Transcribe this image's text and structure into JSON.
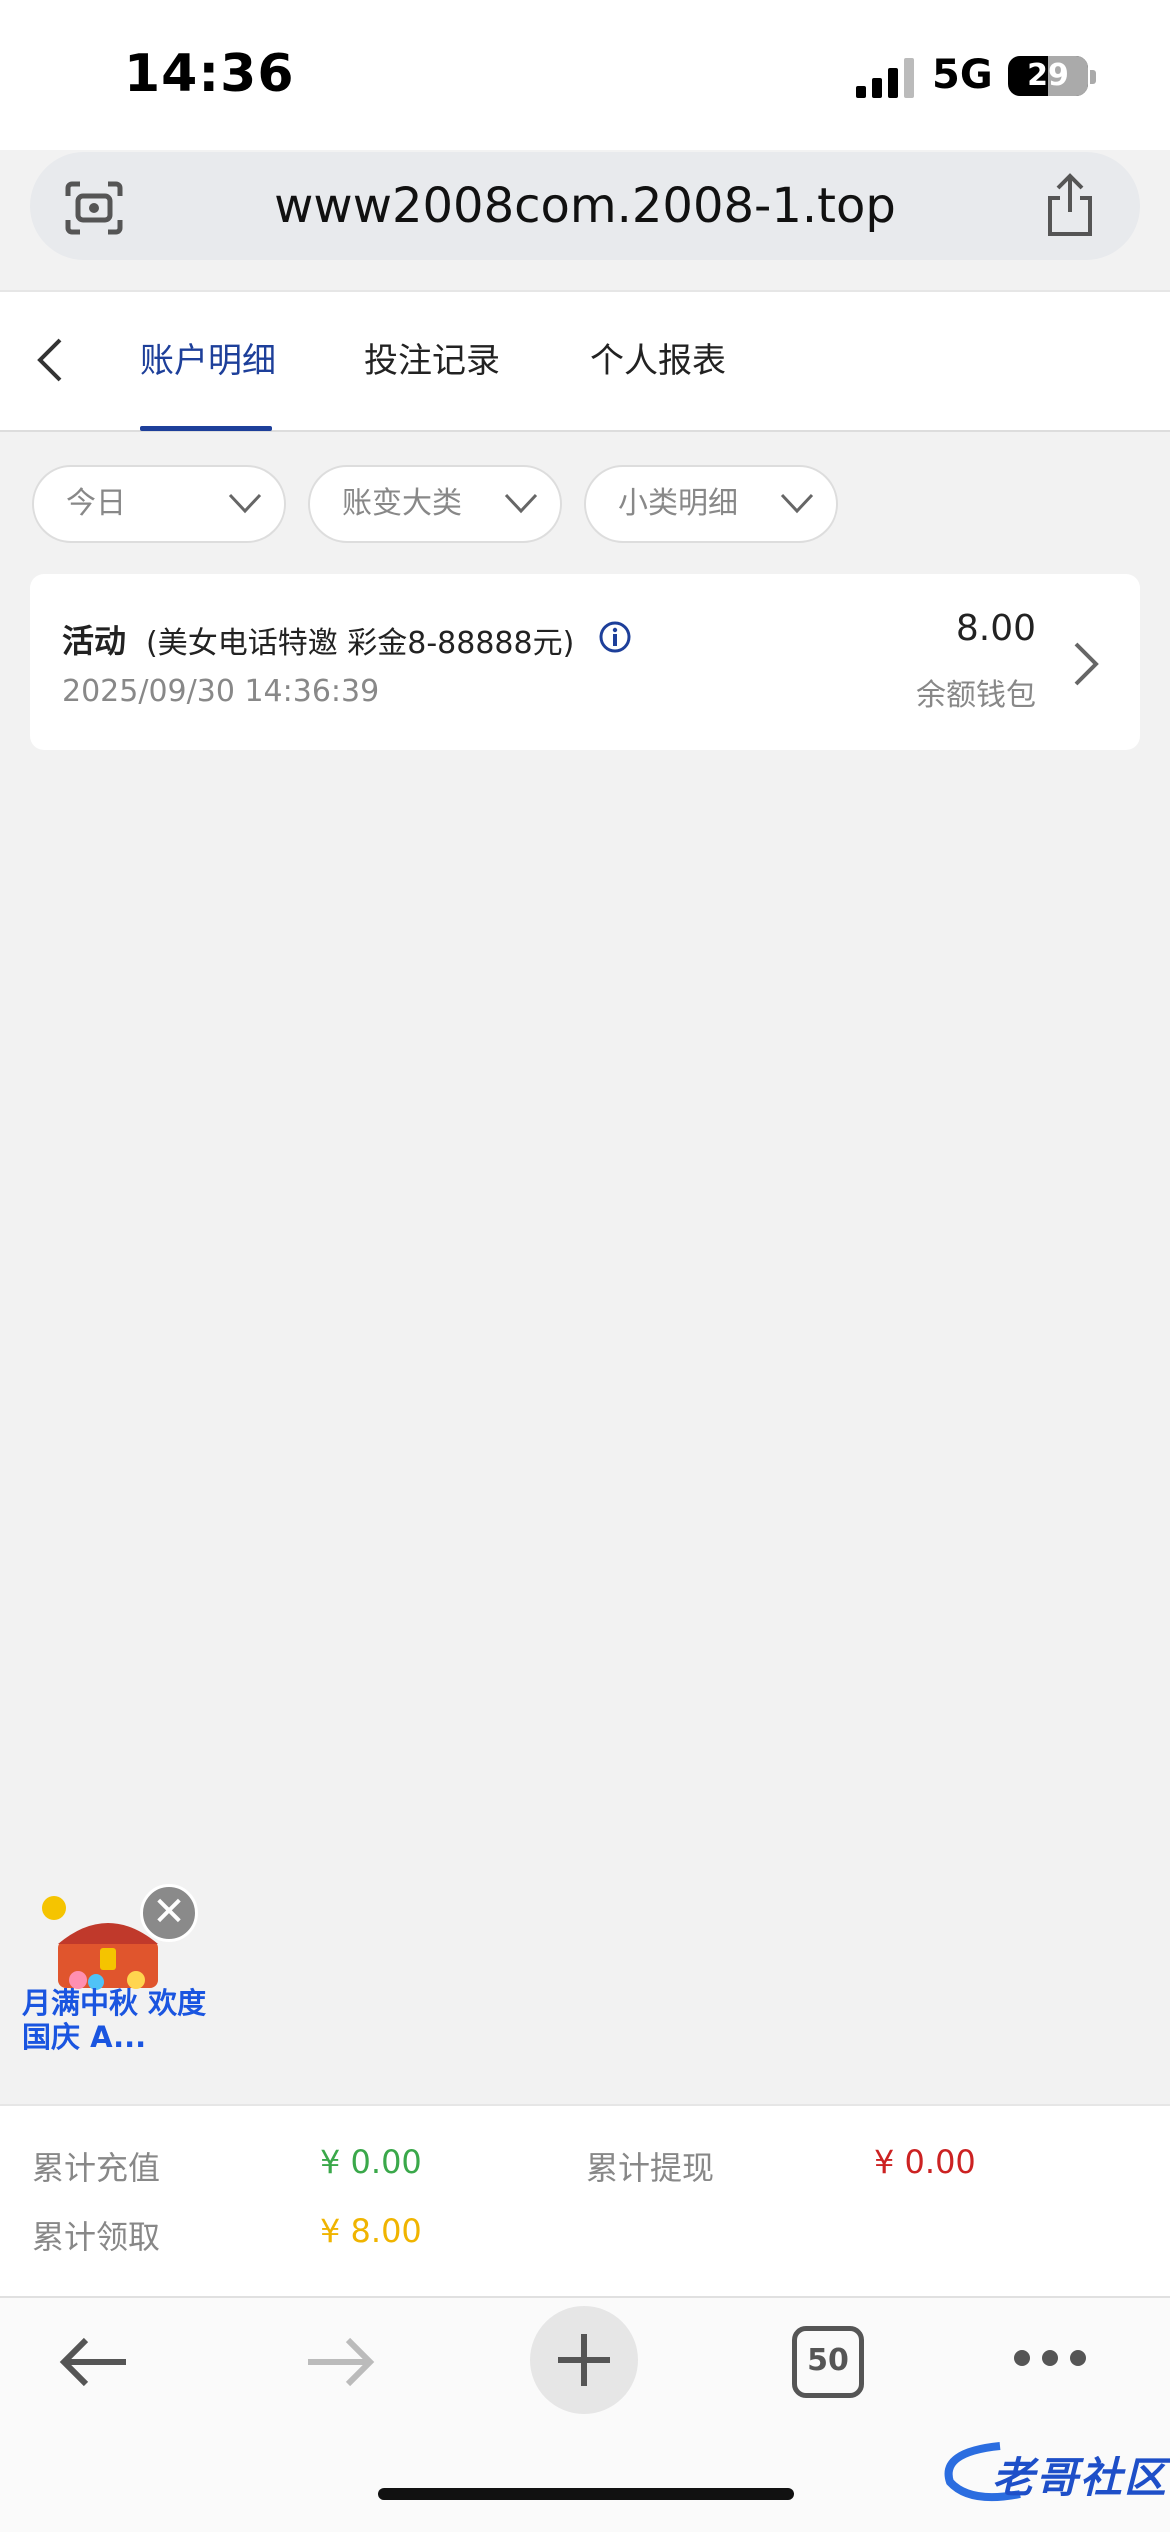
{
  "status_bar": {
    "time": "14:36",
    "network": "5G",
    "battery": "29",
    "battery_level": 0.29
  },
  "browser": {
    "url": "www2008com.2008-1.top",
    "tab_count": "50"
  },
  "tabs": [
    {
      "label": "账户明细",
      "active": true
    },
    {
      "label": "投注记录",
      "active": false
    },
    {
      "label": "个人报表",
      "active": false
    }
  ],
  "filters": [
    {
      "label": "今日"
    },
    {
      "label": "账变大类"
    },
    {
      "label": "小类明细"
    }
  ],
  "record": {
    "type": "活动",
    "description": "(美女电话特邀 彩金8-88888元)",
    "timestamp": "2025/09/30 14:36:39",
    "amount": "8.00",
    "wallet": "余额钱包"
  },
  "promo": {
    "text": "月满中秋 欢度国庆 A..."
  },
  "summary": {
    "recharge_label": "累计充值",
    "recharge_value": "¥ 0.00",
    "withdraw_label": "累计提现",
    "withdraw_value": "¥ 0.00",
    "claim_label": "累计领取",
    "claim_value": "¥ 8.00"
  },
  "colors": {
    "accent": "#1d3f9a",
    "recharge": "#3aa84a",
    "withdraw": "#cc2222",
    "claim": "#f0b400"
  },
  "watermark": {
    "text": "老哥社区"
  }
}
